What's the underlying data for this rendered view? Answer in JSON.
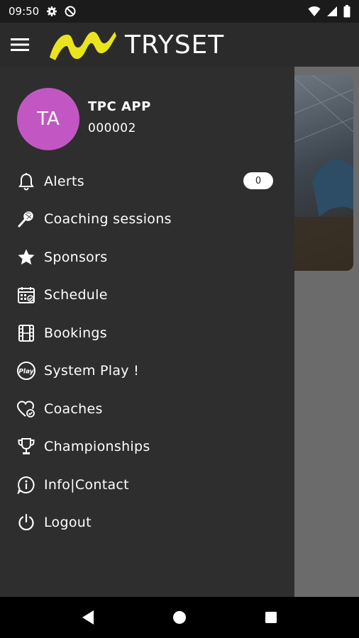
{
  "status_bar": {
    "time": "09:50"
  },
  "app_bar": {
    "logo_text": "TRYSET",
    "logo_accent": "#e9e41c"
  },
  "user": {
    "initials": "TA",
    "name": "TPC APP",
    "id": "000002",
    "avatar_color": "#c257c4"
  },
  "menu": [
    {
      "label": "Alerts",
      "icon": "bell-icon",
      "badge": "0"
    },
    {
      "label": "Coaching sessions",
      "icon": "racket-icon"
    },
    {
      "label": "Sponsors",
      "icon": "star-icon"
    },
    {
      "label": "Schedule",
      "icon": "calendar-icon"
    },
    {
      "label": "Bookings",
      "icon": "film-strip-icon"
    },
    {
      "label": "System Play !",
      "icon": "play-badge-icon"
    },
    {
      "label": "Coaches",
      "icon": "heart-check-icon"
    },
    {
      "label": "Championships",
      "icon": "trophy-icon"
    },
    {
      "label": "Info|Contact",
      "icon": "info-bubble-icon"
    },
    {
      "label": "Logout",
      "icon": "power-icon"
    }
  ]
}
